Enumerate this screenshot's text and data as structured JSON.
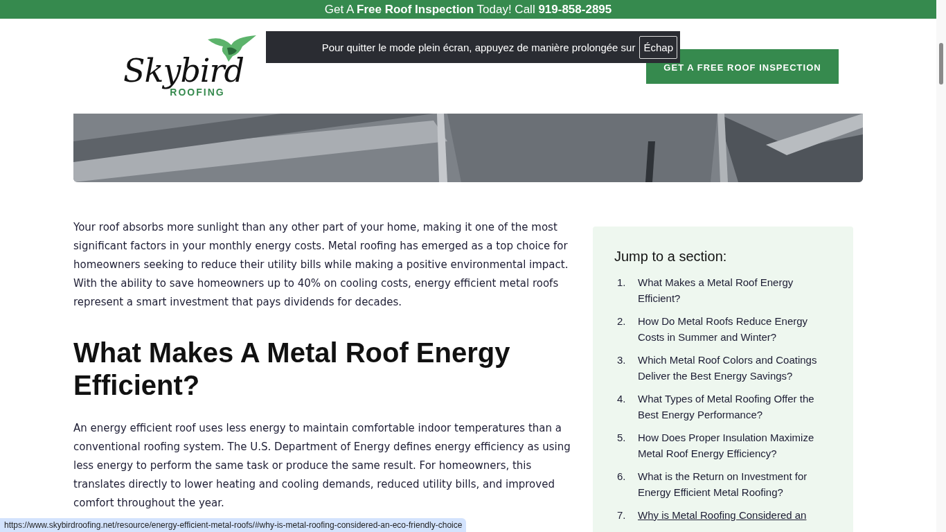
{
  "promo_bar": {
    "text": "Get A **Free Roof Inspection** Today! Call **919-858-2895**"
  },
  "header": {
    "logo": {
      "name": "Skybird",
      "tagline": "ROOFING"
    },
    "cta": "GET A FREE ROOF INSPECTION"
  },
  "fullscreen_toast": {
    "text": "Pour quitter le mode plein écran, appuyez de manière prolongée sur",
    "key": "Échap"
  },
  "article": {
    "intro": "Your roof absorbs more sunlight than any other part of your home, making it one of the most significant factors in your monthly energy costs. Metal roofing has emerged as a top choice for homeowners seeking to reduce their utility bills while making a positive environmental impact. With the ability to save homeowners up to 40% on cooling costs, energy efficient metal roofs represent a smart investment that pays dividends for decades.",
    "heading": "What Makes A Metal Roof Energy Efficient?",
    "paragraph": "An energy efficient roof uses less energy to maintain comfortable indoor temperatures than a conventional roofing system. The U.S. Department of Energy defines energy efficiency as using less energy to perform the same task or produce the same result. For homeowners, this translates directly to lower heating and cooling demands, reduced utility bills, and improved comfort throughout the year."
  },
  "toc": {
    "title": "Jump to a section:",
    "items": [
      {
        "number": "1.",
        "text": "What Makes a Metal Roof Energy Efficient?",
        "hovered": false
      },
      {
        "number": "2.",
        "text": "How Do Metal Roofs Reduce Energy Costs in Summer and Winter?",
        "hovered": false
      },
      {
        "number": "3.",
        "text": "Which Metal Roof Colors and Coatings Deliver the Best Energy Savings?",
        "hovered": false
      },
      {
        "number": "4.",
        "text": "What Types of Metal Roofing Offer the Best Energy Performance?",
        "hovered": false
      },
      {
        "number": "5.",
        "text": "How Does Proper Insulation Maximize Metal Roof Energy Efficiency?",
        "hovered": false
      },
      {
        "number": "6.",
        "text": "What is the Return on Investment for Energy Efficient Metal Roofing?",
        "hovered": false
      },
      {
        "number": "7.",
        "text": "Why is Metal Roofing Considered an",
        "hovered": true
      }
    ]
  },
  "status_url": "https://www.skybirdroofing.net/resource/energy-efficient-metal-roofs/#why-is-metal-roofing-considered-an-eco-friendly-choice"
}
